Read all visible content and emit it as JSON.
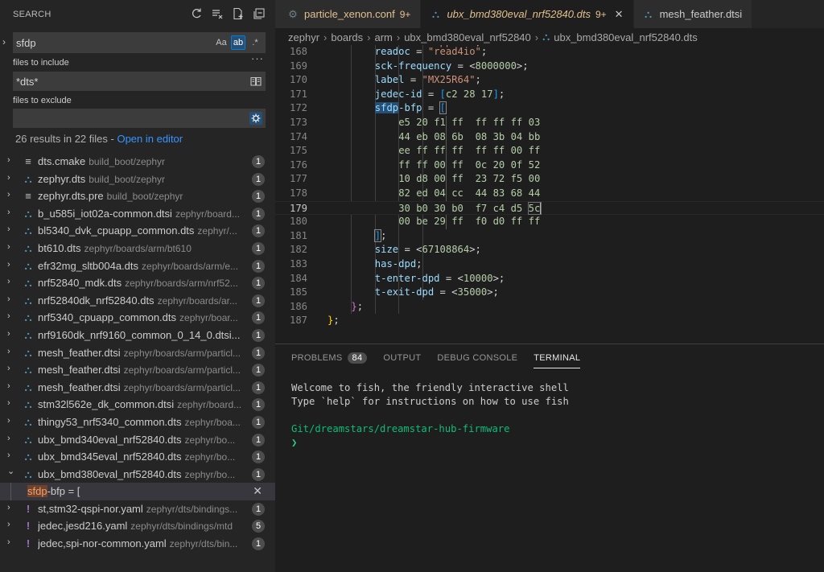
{
  "sidebar": {
    "title": "SEARCH",
    "search_value": "sfdp",
    "opt_case": "Aa",
    "opt_word": "ab",
    "opt_regex": ".*",
    "more": "···",
    "include_label": "files to include",
    "include_value": "*dts*",
    "exclude_label": "files to exclude",
    "exclude_value": "",
    "summary": "26 results in 22 files - ",
    "open_in_editor": "Open in editor",
    "results": [
      {
        "name": "dts.cmake",
        "path": "build_boot/zephyr",
        "count": "1",
        "icon": "lines",
        "expanded": false
      },
      {
        "name": "zephyr.dts",
        "path": "build_boot/zephyr",
        "count": "1",
        "icon": "tree",
        "expanded": false
      },
      {
        "name": "zephyr.dts.pre",
        "path": "build_boot/zephyr",
        "count": "1",
        "icon": "lines",
        "expanded": false
      },
      {
        "name": "b_u585i_iot02a-common.dtsi",
        "path": "zephyr/board...",
        "count": "1",
        "icon": "tree",
        "expanded": false
      },
      {
        "name": "bl5340_dvk_cpuapp_common.dts",
        "path": "zephyr/...",
        "count": "1",
        "icon": "tree",
        "expanded": false
      },
      {
        "name": "bt610.dts",
        "path": "zephyr/boards/arm/bt610",
        "count": "1",
        "icon": "tree",
        "expanded": false
      },
      {
        "name": "efr32mg_sltb004a.dts",
        "path": "zephyr/boards/arm/e...",
        "count": "1",
        "icon": "tree",
        "expanded": false
      },
      {
        "name": "nrf52840_mdk.dts",
        "path": "zephyr/boards/arm/nrf52...",
        "count": "1",
        "icon": "tree",
        "expanded": false
      },
      {
        "name": "nrf52840dk_nrf52840.dts",
        "path": "zephyr/boards/ar...",
        "count": "1",
        "icon": "tree",
        "expanded": false
      },
      {
        "name": "nrf5340_cpuapp_common.dts",
        "path": "zephyr/boar...",
        "count": "1",
        "icon": "tree",
        "expanded": false
      },
      {
        "name": "nrf9160dk_nrf9160_common_0_14_0.dtsi...",
        "path": "",
        "count": "1",
        "icon": "tree",
        "expanded": false
      },
      {
        "name": "mesh_feather.dtsi",
        "path": "zephyr/boards/arm/particl...",
        "count": "1",
        "icon": "tree",
        "expanded": false
      },
      {
        "name": "mesh_feather.dtsi",
        "path": "zephyr/boards/arm/particl...",
        "count": "1",
        "icon": "tree",
        "expanded": false
      },
      {
        "name": "mesh_feather.dtsi",
        "path": "zephyr/boards/arm/particl...",
        "count": "1",
        "icon": "tree",
        "expanded": false
      },
      {
        "name": "stm32l562e_dk_common.dtsi",
        "path": "zephyr/board...",
        "count": "1",
        "icon": "tree",
        "expanded": false
      },
      {
        "name": "thingy53_nrf5340_common.dts",
        "path": "zephyr/boa...",
        "count": "1",
        "icon": "tree",
        "expanded": false
      },
      {
        "name": "ubx_bmd340eval_nrf52840.dts",
        "path": "zephyr/bo...",
        "count": "1",
        "icon": "tree",
        "expanded": false
      },
      {
        "name": "ubx_bmd345eval_nrf52840.dts",
        "path": "zephyr/bo...",
        "count": "1",
        "icon": "tree",
        "expanded": false
      },
      {
        "name": "ubx_bmd380eval_nrf52840.dts",
        "path": "zephyr/bo...",
        "count": "1",
        "icon": "tree",
        "expanded": true
      }
    ],
    "match": {
      "highlight": "sfdp",
      "rest": "-bfp = [",
      "close": "✕"
    },
    "results_after": [
      {
        "name": "st,stm32-qspi-nor.yaml",
        "path": "zephyr/dts/bindings...",
        "count": "1",
        "icon": "yaml"
      },
      {
        "name": "jedec,jesd216.yaml",
        "path": "zephyr/dts/bindings/mtd",
        "count": "5",
        "icon": "yaml"
      },
      {
        "name": "jedec,spi-nor-common.yaml",
        "path": "zephyr/dts/bin...",
        "count": "1",
        "icon": "yaml"
      }
    ]
  },
  "tabs": [
    {
      "label": "particle_xenon.conf",
      "count": "9+",
      "icon": "gear",
      "active": false
    },
    {
      "label": "ubx_bmd380eval_nrf52840.dts",
      "count": "9+",
      "icon": "tree",
      "active": true
    },
    {
      "label": "mesh_feather.dtsi",
      "count": "",
      "icon": "tree",
      "active": false
    }
  ],
  "breadcrumb": [
    "zephyr",
    "boards",
    "arm",
    "ubx_bmd380eval_nrf52840",
    "ubx_bmd380eval_nrf52840.dts"
  ],
  "code": {
    "current_line": "179",
    "lines": [
      {
        "n": "168",
        "indent": 5,
        "text": "readoc = \"read4io\";"
      },
      {
        "n": "169",
        "indent": 5,
        "text": "sck-frequency = <8000000>;"
      },
      {
        "n": "170",
        "indent": 5,
        "text": "label = \"MX25R64\";"
      },
      {
        "n": "171",
        "indent": 5,
        "text": "jedec-id = [c2 28 17];"
      },
      {
        "n": "172",
        "indent": 5,
        "text": "sfdp-bfp = ["
      },
      {
        "n": "173",
        "indent": 6,
        "text": "e5 20 f1 ff  ff ff ff 03"
      },
      {
        "n": "174",
        "indent": 6,
        "text": "44 eb 08 6b  08 3b 04 bb"
      },
      {
        "n": "175",
        "indent": 6,
        "text": "ee ff ff ff  ff ff 00 ff"
      },
      {
        "n": "176",
        "indent": 6,
        "text": "ff ff 00 ff  0c 20 0f 52"
      },
      {
        "n": "177",
        "indent": 6,
        "text": "10 d8 00 ff  23 72 f5 00"
      },
      {
        "n": "178",
        "indent": 6,
        "text": "82 ed 04 cc  44 83 68 44"
      },
      {
        "n": "179",
        "indent": 6,
        "text": "30 b0 30 b0  f7 c4 d5 5c"
      },
      {
        "n": "180",
        "indent": 6,
        "text": "00 be 29 ff  f0 d0 ff ff"
      },
      {
        "n": "181",
        "indent": 5,
        "text": "];"
      },
      {
        "n": "182",
        "indent": 5,
        "text": "size = <67108864>;"
      },
      {
        "n": "183",
        "indent": 5,
        "text": "has-dpd;"
      },
      {
        "n": "184",
        "indent": 5,
        "text": "t-enter-dpd = <10000>;"
      },
      {
        "n": "185",
        "indent": 5,
        "text": "t-exit-dpd = <35000>;"
      },
      {
        "n": "186",
        "indent": 4,
        "text": "};"
      },
      {
        "n": "187",
        "indent": 3,
        "text": "};"
      }
    ]
  },
  "panel": {
    "tabs": [
      {
        "label": "PROBLEMS",
        "badge": "84",
        "active": false
      },
      {
        "label": "OUTPUT",
        "badge": "",
        "active": false
      },
      {
        "label": "DEBUG CONSOLE",
        "badge": "",
        "active": false
      },
      {
        "label": "TERMINAL",
        "badge": "",
        "active": true
      }
    ],
    "terminal": {
      "line1": "Welcome to fish, the friendly interactive shell",
      "line2": "Type `help` for instructions on how to use fish",
      "cwd": "Git/dreamstars/dreamstar-hub-firmware",
      "prompt": "❯"
    }
  },
  "colors": {
    "accent": "#007fd4",
    "modified": "#e2c08d",
    "link": "#3794ff",
    "terminal_path": "#0dbc79"
  }
}
